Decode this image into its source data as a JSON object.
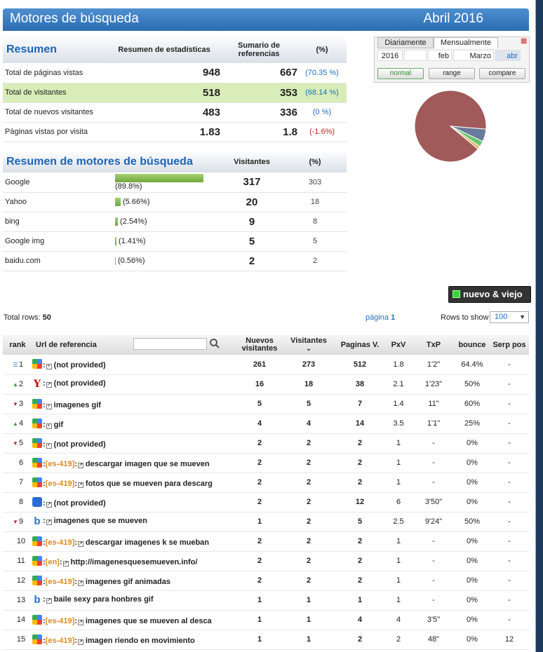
{
  "header": {
    "title": "Motores de búsqueda",
    "month": "Abril 2016"
  },
  "summary": {
    "title": "Resumen",
    "col1": "Resumen de estadísticas",
    "col2": "Sumario de referencias",
    "col3": "(%)",
    "rows": [
      {
        "label": "Total de páginas vistas",
        "total": "948",
        "ref": "667",
        "pct": "(70.35 %)"
      },
      {
        "label": "Total de visitantes",
        "total": "518",
        "ref": "353",
        "pct": "(68.14 %)"
      },
      {
        "label": "Total de nuevos visitantes",
        "total": "483",
        "ref": "336",
        "pct": "(0 %)"
      },
      {
        "label": "Páginas vistas por visita",
        "total": "1.83",
        "ref": "1.8",
        "pct": "(-1.6%)"
      }
    ]
  },
  "engines": {
    "title": "Resumen de motores de búsqueda",
    "col_visitors": "Visitantes",
    "col_pct": "(%)",
    "rows": [
      {
        "name": "Google",
        "share": 0.898,
        "pct": "(89.8%)",
        "visitors": "317",
        "extra": "303"
      },
      {
        "name": "Yahoo",
        "share": 0.0566,
        "pct": "(5.66%)",
        "visitors": "20",
        "extra": "18"
      },
      {
        "name": "bing",
        "share": 0.0254,
        "pct": "(2.54%)",
        "visitors": "9",
        "extra": "8"
      },
      {
        "name": "Google img",
        "share": 0.0141,
        "pct": "(1.41%)",
        "visitors": "5",
        "extra": "5"
      },
      {
        "name": "baidu.com",
        "share": 0.0056,
        "pct": "(0.56%)",
        "visitors": "2",
        "extra": "2"
      }
    ]
  },
  "period": {
    "tabs": [
      "Diariamente",
      "Mensualmente"
    ],
    "year": "2016",
    "months": [
      "feb",
      "Marzo",
      "abr"
    ],
    "modes": [
      "normal",
      "range",
      "compare"
    ]
  },
  "pie": {
    "colors": [
      "#a05a5a",
      "#6a7a9a",
      "#6ac46a",
      "#e0b870"
    ],
    "values": [
      0.898,
      0.0566,
      0.0254,
      0.0141
    ]
  },
  "toolbar": {
    "nuevo_viejo": "nuevo & viejo",
    "total_rows_label": "Total rows:",
    "total_rows": "50",
    "page_label": "página",
    "page": "1",
    "rows_label": "Rows to show",
    "rows_value": "100"
  },
  "table": {
    "headers": {
      "rank": "rank",
      "url": "Url de referencia",
      "nuevos": "Nuevos visitantes",
      "visitantes": "Visitantes",
      "paginas": "Paginas V.",
      "pxv": "PxV",
      "txp": "TxP",
      "bounce": "bounce",
      "serp": "Serp pos"
    },
    "rows": [
      {
        "rank": "1",
        "trend": "new",
        "engine": "google",
        "lang": "",
        "box": "+",
        "url": "(not provided)",
        "nuevos": "261",
        "visitantes": "273",
        "paginas": "512",
        "pxv": "1.8",
        "txp": "1'2\"",
        "bounce": "64.4%",
        "serp": "-"
      },
      {
        "rank": "2",
        "trend": "up",
        "engine": "yahoo",
        "lang": "",
        "box": "↗",
        "url": "(not provided)",
        "nuevos": "16",
        "visitantes": "18",
        "paginas": "38",
        "pxv": "2.1",
        "txp": "1'23\"",
        "bounce": "50%",
        "serp": "-"
      },
      {
        "rank": "3",
        "trend": "down",
        "engine": "google",
        "lang": "",
        "box": "+",
        "url": "imagenes gif",
        "nuevos": "5",
        "visitantes": "5",
        "paginas": "7",
        "pxv": "1.4",
        "txp": "11\"",
        "bounce": "60%",
        "serp": "-"
      },
      {
        "rank": "4",
        "trend": "up",
        "engine": "google",
        "lang": "",
        "box": "+",
        "url": "gif",
        "nuevos": "4",
        "visitantes": "4",
        "paginas": "14",
        "pxv": "3.5",
        "txp": "1'1\"",
        "bounce": "25%",
        "serp": "-"
      },
      {
        "rank": "5",
        "trend": "down",
        "engine": "google",
        "lang": "",
        "box": "+",
        "url": "(not provided)",
        "nuevos": "2",
        "visitantes": "2",
        "paginas": "2",
        "pxv": "1",
        "txp": "-",
        "bounce": "0%",
        "serp": "-"
      },
      {
        "rank": "6",
        "trend": "",
        "engine": "google",
        "lang": "[es-419]",
        "box": "↗",
        "url": "descargar imagen que se mueven",
        "nuevos": "2",
        "visitantes": "2",
        "paginas": "2",
        "pxv": "1",
        "txp": "-",
        "bounce": "0%",
        "serp": "-"
      },
      {
        "rank": "7",
        "trend": "",
        "engine": "google",
        "lang": "[es-419]",
        "box": "↗",
        "url": "fotos que se mueven para descarg",
        "nuevos": "2",
        "visitantes": "2",
        "paginas": "2",
        "pxv": "1",
        "txp": "-",
        "bounce": "0%",
        "serp": "-"
      },
      {
        "rank": "8",
        "trend": "",
        "engine": "baidu",
        "lang": "",
        "box": "↗",
        "url": "(not provided)",
        "nuevos": "2",
        "visitantes": "2",
        "paginas": "12",
        "pxv": "6",
        "txp": "3'50\"",
        "bounce": "0%",
        "serp": "-"
      },
      {
        "rank": "9",
        "trend": "down",
        "engine": "bing",
        "lang": "",
        "box": "↗",
        "url": "imagenes que se mueven",
        "nuevos": "1",
        "visitantes": "2",
        "paginas": "5",
        "pxv": "2.5",
        "txp": "9'24\"",
        "bounce": "50%",
        "serp": "-"
      },
      {
        "rank": "10",
        "trend": "",
        "engine": "google",
        "lang": "[es-419]",
        "box": "↗",
        "url": "descargar imagenes k se mueban",
        "nuevos": "2",
        "visitantes": "2",
        "paginas": "2",
        "pxv": "1",
        "txp": "-",
        "bounce": "0%",
        "serp": "-"
      },
      {
        "rank": "11",
        "trend": "",
        "engine": "google",
        "lang": "[en]",
        "box": "↗",
        "url": "http://imagenesquesemueven.info/",
        "nuevos": "2",
        "visitantes": "2",
        "paginas": "2",
        "pxv": "1",
        "txp": "-",
        "bounce": "0%",
        "serp": "-"
      },
      {
        "rank": "12",
        "trend": "",
        "engine": "google",
        "lang": "[es-419]",
        "box": "↗",
        "url": "imagenes gif animadas",
        "nuevos": "2",
        "visitantes": "2",
        "paginas": "2",
        "pxv": "1",
        "txp": "-",
        "bounce": "0%",
        "serp": "-"
      },
      {
        "rank": "13",
        "trend": "",
        "engine": "bing",
        "lang": "",
        "box": "↗",
        "url": "baile sexy para honbres gif",
        "nuevos": "1",
        "visitantes": "1",
        "paginas": "1",
        "pxv": "1",
        "txp": "-",
        "bounce": "0%",
        "serp": "-"
      },
      {
        "rank": "14",
        "trend": "",
        "engine": "google",
        "lang": "[es-419]",
        "box": "↗",
        "url": "imagenes que se mueven al desca",
        "nuevos": "1",
        "visitantes": "1",
        "paginas": "4",
        "pxv": "4",
        "txp": "3'5\"",
        "bounce": "0%",
        "serp": "-"
      },
      {
        "rank": "15",
        "trend": "",
        "engine": "google",
        "lang": "[es-419]",
        "box": "↗",
        "url": "imagen riendo en movimiento",
        "nuevos": "1",
        "visitantes": "1",
        "paginas": "2",
        "pxv": "2",
        "txp": "48\"",
        "bounce": "0%",
        "serp": "12"
      }
    ]
  }
}
